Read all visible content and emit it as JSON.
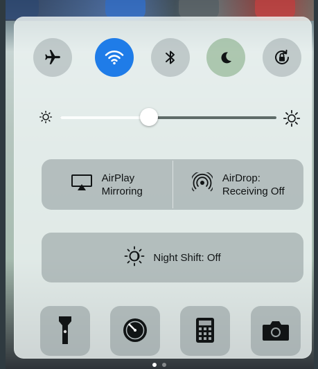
{
  "toggles": [
    {
      "name": "airplane-mode-toggle",
      "icon": "airplane-icon",
      "active": false
    },
    {
      "name": "wifi-toggle",
      "icon": "wifi-icon",
      "active": true
    },
    {
      "name": "bluetooth-toggle",
      "icon": "bluetooth-icon",
      "active": false
    },
    {
      "name": "do-not-disturb-toggle",
      "icon": "moon-icon",
      "active": false
    },
    {
      "name": "rotation-lock-toggle",
      "icon": "rotation-lock-icon",
      "active": false
    }
  ],
  "brightness": {
    "min_icon": "brightness-low-icon",
    "max_icon": "brightness-high-icon",
    "level": 0.41
  },
  "airplay": {
    "line1": "AirPlay",
    "line2": "Mirroring",
    "icon": "airplay-icon"
  },
  "airdrop": {
    "line1": "AirDrop:",
    "line2": "Receiving Off",
    "icon": "airdrop-icon"
  },
  "night_shift": {
    "label": "Night Shift: Off",
    "icon": "night-shift-icon"
  },
  "app_shortcuts": [
    {
      "name": "flashlight-button",
      "icon": "flashlight-icon"
    },
    {
      "name": "timer-button",
      "icon": "timer-icon"
    },
    {
      "name": "calculator-button",
      "icon": "calculator-icon"
    },
    {
      "name": "camera-button",
      "icon": "camera-icon"
    }
  ],
  "page_indicator": {
    "pages": 2,
    "current": 1
  },
  "colors": {
    "active_toggle": "#1f7ce8",
    "panel_bg": "rgba(236,243,242,0.83)"
  }
}
